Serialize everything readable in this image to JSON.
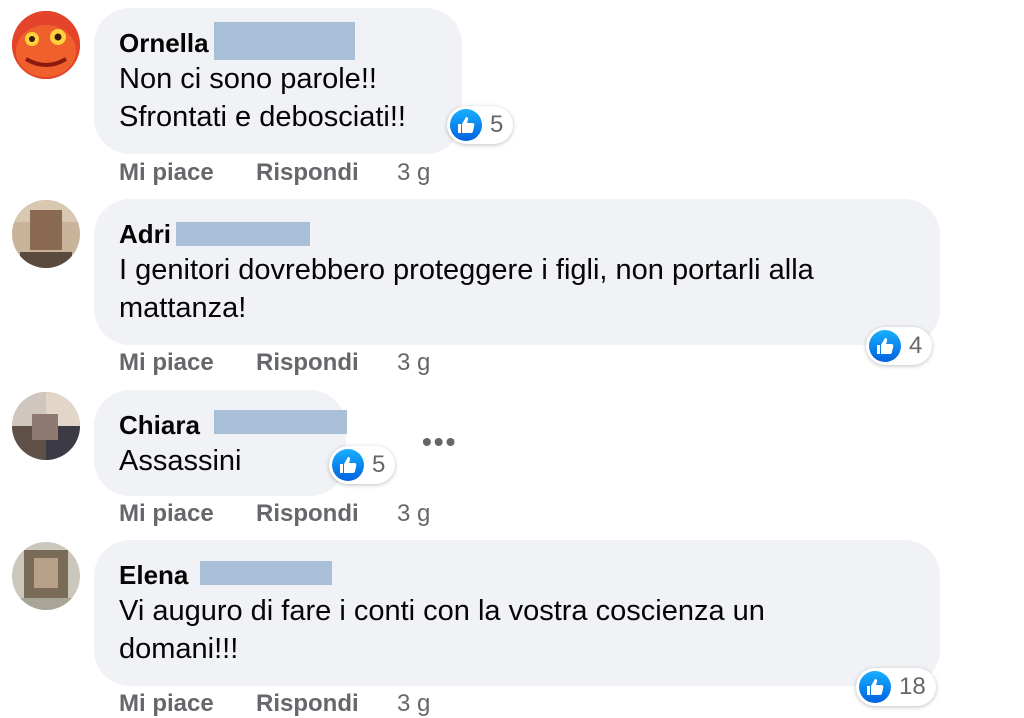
{
  "comments": [
    {
      "name": "Ornella",
      "lines": [
        "Non ci sono parole!!",
        "Sfrontati e debosciati!!"
      ],
      "likes": "5",
      "actions": {
        "like": "Mi piace",
        "reply": "Rispondi",
        "time": "3 g"
      }
    },
    {
      "name": "Adri",
      "lines": [
        "I genitori dovrebbero proteggere i figli, non portarli alla",
        "mattanza!"
      ],
      "likes": "4",
      "actions": {
        "like": "Mi piace",
        "reply": "Rispondi",
        "time": "3 g"
      }
    },
    {
      "name": "Chiara",
      "lines": [
        "Assassini"
      ],
      "likes": "5",
      "actions": {
        "like": "Mi piace",
        "reply": "Rispondi",
        "time": "3 g"
      }
    },
    {
      "name": "Elena",
      "lines": [
        "Vi auguro di fare i conti con la vostra coscienza un",
        "domani!!!"
      ],
      "likes": "18",
      "actions": {
        "like": "Mi piace",
        "reply": "Rispondi",
        "time": "3 g"
      }
    }
  ],
  "more_options": "•••",
  "colors": {
    "bubble": "#f0f2f5",
    "redaction": "#a9bfd8",
    "like_blue": "#1877f2",
    "meta_gray": "#65676b"
  },
  "icons": {
    "reaction": "thumbs-up-icon",
    "menu": "more-options-icon"
  }
}
